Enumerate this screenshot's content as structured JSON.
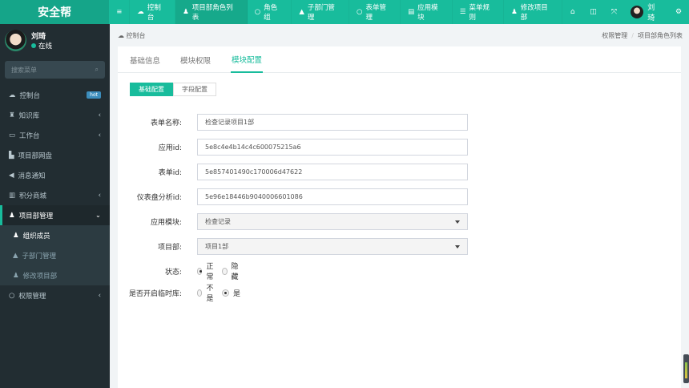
{
  "app": {
    "logo": "安全帮"
  },
  "topnav": {
    "items": [
      {
        "icon": "menu-icon",
        "glyph": "≡",
        "label": ""
      },
      {
        "icon": "dashboard-icon",
        "glyph": "☁",
        "label": "控制台"
      },
      {
        "icon": "user-icon",
        "glyph": "♟",
        "label": "项目部角色列表",
        "active": true
      },
      {
        "icon": "circle-icon",
        "glyph": "○",
        "label": "角色组"
      },
      {
        "icon": "briefcase-icon",
        "glyph": "▲",
        "label": "子部门管理"
      },
      {
        "icon": "circle-icon",
        "glyph": "○",
        "label": "表单管理"
      },
      {
        "icon": "list-alt-icon",
        "glyph": "▤",
        "label": "应用模块"
      },
      {
        "icon": "bars-icon",
        "glyph": "☰",
        "label": "菜单规则"
      },
      {
        "icon": "user-icon",
        "glyph": "♟",
        "label": "修改项目部"
      }
    ],
    "right": {
      "user": "刘琦"
    }
  },
  "sidebar": {
    "user": {
      "name": "刘琦",
      "status": "在线"
    },
    "search_placeholder": "搜索菜单",
    "items": [
      {
        "label": "控制台",
        "glyph": "☁",
        "badge": "hot"
      },
      {
        "label": "知识库",
        "glyph": "♜",
        "chevron": "‹"
      },
      {
        "label": "工作台",
        "glyph": "▭",
        "chevron": "‹"
      },
      {
        "label": "项目部网盘",
        "glyph": "▙"
      },
      {
        "label": "消息通知",
        "glyph": "◀"
      },
      {
        "label": "积分商城",
        "glyph": "▥",
        "chevron": "‹"
      },
      {
        "label": "项目部管理",
        "glyph": "♟",
        "chevron": "⌄"
      },
      {
        "label": "组织成员",
        "glyph": "♟"
      },
      {
        "label": "子部门管理",
        "glyph": "▲"
      },
      {
        "label": "修改项目部",
        "glyph": "♟"
      },
      {
        "label": "权限管理",
        "glyph": "○",
        "chevron": "‹"
      }
    ]
  },
  "breadcrumb": {
    "left": "控制台",
    "items": [
      "权限管理",
      "项目部角色列表"
    ]
  },
  "tabs": [
    "基础信息",
    "模块权限",
    "模块配置"
  ],
  "subtabs": [
    "基础配置",
    "字段配置"
  ],
  "form": {
    "name_label": "表单名称:",
    "name_value": "检查记录项目1部",
    "app_label": "应用id:",
    "app_value": "5e8c4e4b14c4c600075215a6",
    "form_label": "表单id:",
    "form_value": "5e857401490c170006d47622",
    "dash_label": "仪表盘分析id:",
    "dash_value": "5e96e18446b9040006601086",
    "module_label": "应用模块:",
    "module_value": "检查记录",
    "dept_label": "项目部:",
    "dept_value": "项目1部",
    "status_label": "状态:",
    "status_options": [
      "正常",
      "隐藏"
    ],
    "status_selected": "正常",
    "temp_label": "是否开启临时库:",
    "temp_options": [
      "不是",
      "是"
    ],
    "temp_selected": "是"
  },
  "colors": {
    "accent": "#18bc9c",
    "sidebar": "#222d32"
  }
}
